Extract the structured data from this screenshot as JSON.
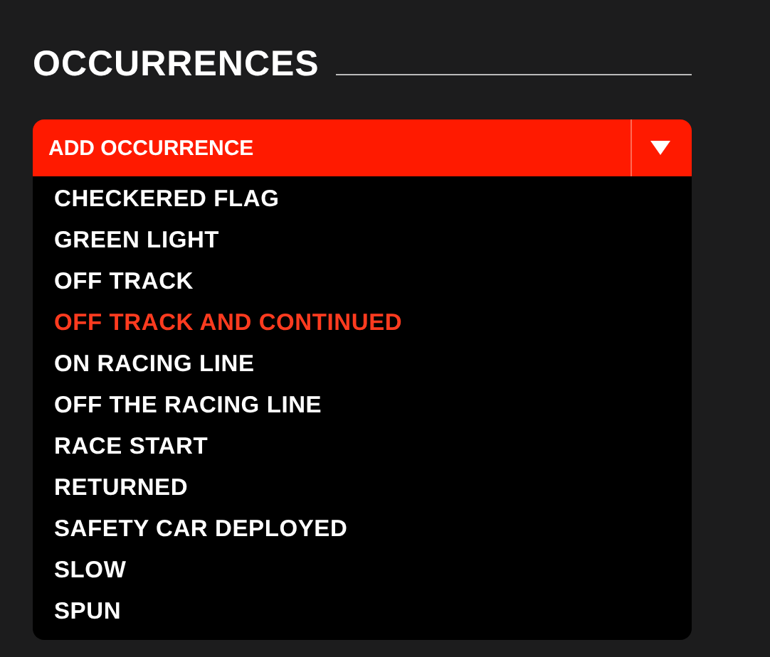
{
  "section": {
    "title": "OCCURRENCES"
  },
  "dropdown": {
    "label": "ADD OCCURRENCE",
    "expanded": true,
    "options": [
      {
        "label": "CHECKERED FLAG",
        "selected": false
      },
      {
        "label": "GREEN LIGHT",
        "selected": false
      },
      {
        "label": "OFF TRACK",
        "selected": false
      },
      {
        "label": "OFF TRACK AND CONTINUED",
        "selected": true
      },
      {
        "label": "ON RACING LINE",
        "selected": false
      },
      {
        "label": "OFF THE RACING LINE",
        "selected": false
      },
      {
        "label": "RACE START",
        "selected": false
      },
      {
        "label": "RETURNED",
        "selected": false
      },
      {
        "label": "SAFETY CAR DEPLOYED",
        "selected": false
      },
      {
        "label": "SLOW",
        "selected": false
      },
      {
        "label": "SPUN",
        "selected": false
      }
    ]
  }
}
